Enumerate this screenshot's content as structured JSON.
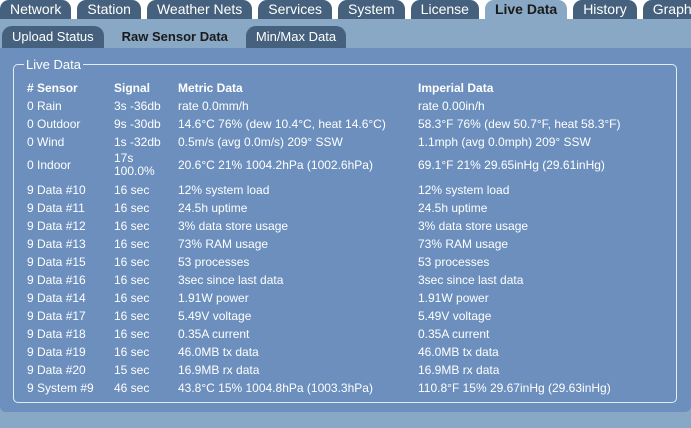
{
  "top_tabs": [
    "Network",
    "Station",
    "Weather Nets",
    "Services",
    "System",
    "License",
    "Live Data",
    "History",
    "Graphs"
  ],
  "top_active": "Live Data",
  "sub_tabs": [
    "Upload Status",
    "Raw Sensor Data",
    "Min/Max Data"
  ],
  "sub_active": "Raw Sensor Data",
  "section_title": "Live Data",
  "table": {
    "headers": {
      "sensor": "# Sensor",
      "signal": "Signal",
      "metric": "Metric Data",
      "imperial": "Imperial Data"
    },
    "rows": [
      {
        "sensor": "0 Rain",
        "signal": "3s -36db",
        "metric": "rate 0.0mm/h",
        "imperial": "rate 0.00in/h"
      },
      {
        "sensor": "0 Outdoor",
        "signal": "9s -30db",
        "metric": "14.6°C 76% (dew 10.4°C, heat 14.6°C)",
        "imperial": "58.3°F 76% (dew 50.7°F, heat 58.3°F)"
      },
      {
        "sensor": "0 Wind",
        "signal": "1s -32db",
        "metric": "0.5m/s (avg 0.0m/s) 209° SSW",
        "imperial": "1.1mph (avg 0.0mph) 209° SSW"
      },
      {
        "sensor": "0 Indoor",
        "signal": "17s 100.0%",
        "metric": "20.6°C 21% 1004.2hPa (1002.6hPa)",
        "imperial": "69.1°F 21% 29.65inHg (29.61inHg)"
      },
      {
        "sensor": "9 Data #10",
        "signal": "16 sec",
        "metric": "12% system load",
        "imperial": "12% system load"
      },
      {
        "sensor": "9 Data #11",
        "signal": "16 sec",
        "metric": "24.5h uptime",
        "imperial": "24.5h uptime"
      },
      {
        "sensor": "9 Data #12",
        "signal": "16 sec",
        "metric": "3% data store usage",
        "imperial": "3% data store usage"
      },
      {
        "sensor": "9 Data #13",
        "signal": "16 sec",
        "metric": "73% RAM usage",
        "imperial": "73% RAM usage"
      },
      {
        "sensor": "9 Data #15",
        "signal": "16 sec",
        "metric": "53 processes",
        "imperial": "53 processes"
      },
      {
        "sensor": "9 Data #16",
        "signal": "16 sec",
        "metric": "3sec since last data",
        "imperial": "3sec since last data"
      },
      {
        "sensor": "9 Data #14",
        "signal": "16 sec",
        "metric": "1.91W power",
        "imperial": "1.91W power"
      },
      {
        "sensor": "9 Data #17",
        "signal": "16 sec",
        "metric": "5.49V voltage",
        "imperial": "5.49V voltage"
      },
      {
        "sensor": "9 Data #18",
        "signal": "16 sec",
        "metric": "0.35A current",
        "imperial": "0.35A current"
      },
      {
        "sensor": "9 Data #19",
        "signal": "16 sec",
        "metric": "46.0MB tx data",
        "imperial": "46.0MB tx data"
      },
      {
        "sensor": "9 Data #20",
        "signal": "15 sec",
        "metric": "16.9MB rx data",
        "imperial": "16.9MB rx data"
      },
      {
        "sensor": "9 System #9",
        "signal": "46 sec",
        "metric": "43.8°C 15% 1004.8hPa (1003.3hPa)",
        "imperial": "110.8°F 15% 29.67inHg (29.63inHg)"
      }
    ]
  },
  "colors": {
    "tab_dark": "#46617d",
    "tab_light": "#88a8c5",
    "panel_bg": "#6c8fbd"
  }
}
